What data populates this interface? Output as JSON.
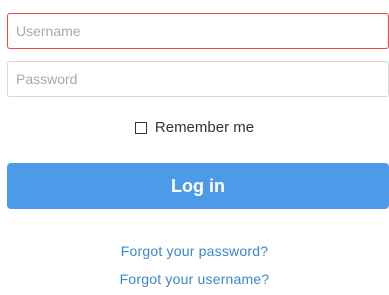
{
  "form": {
    "username": {
      "placeholder": "Username",
      "value": ""
    },
    "password": {
      "placeholder": "Password",
      "value": ""
    },
    "remember_label": "Remember me",
    "remember_checked": false,
    "login_label": "Log in",
    "forgot_password_label": "Forgot your password?",
    "forgot_username_label": "Forgot your username?"
  },
  "colors": {
    "error_border": "#e5484d",
    "button": "#4d9be8",
    "link": "#3c86cf"
  }
}
